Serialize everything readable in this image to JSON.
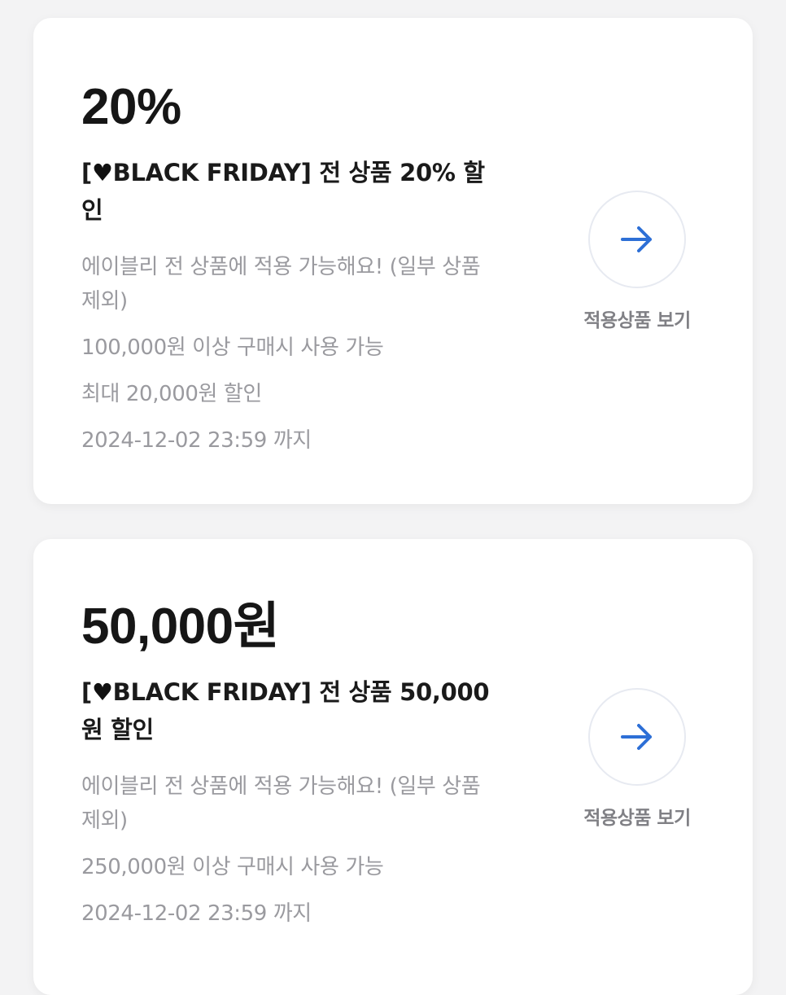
{
  "coupons": [
    {
      "amount": "20%",
      "title_open": "[",
      "title_heart": "♥",
      "title_rest": "BLACK FRIDAY] 전 상품 20% 할인",
      "scope": "에이블리 전 상품에 적용 가능해요! (일부 상품 제외)",
      "min_purchase": "100,000원 이상 구매시 사용 가능",
      "max_discount": "최대 20,000원 할인",
      "expiry": "2024-12-02 23:59 까지",
      "action_label": "적용상품 보기",
      "action_icon": "arrow-right-icon"
    },
    {
      "amount": "50,000원",
      "title_open": "[",
      "title_heart": "♥",
      "title_rest": "BLACK FRIDAY] 전 상품 50,000원 할인",
      "scope": "에이블리 전 상품에 적용 가능해요! (일부 상품 제외)",
      "min_purchase": "250,000원 이상 구매시 사용 가능",
      "expiry": "2024-12-02 23:59 까지",
      "action_label": "적용상품 보기",
      "action_icon": "arrow-right-icon"
    }
  ],
  "colors": {
    "background": "#f3f3f4",
    "card": "#ffffff",
    "arrow": "#2d6fd6",
    "muted_text": "#9a9a9f"
  }
}
